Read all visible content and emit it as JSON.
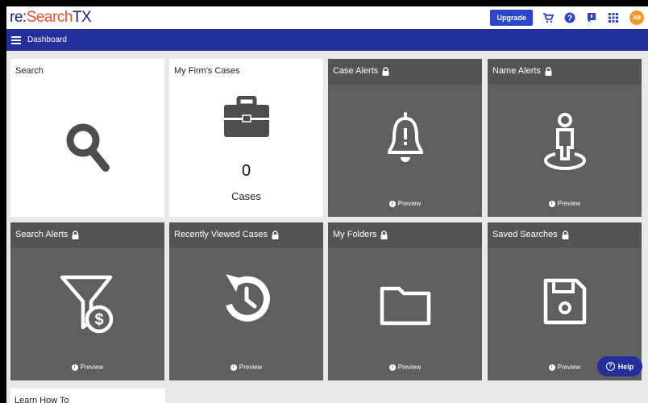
{
  "brand": {
    "part1": "re:",
    "part2": "Search",
    "part3": "TX"
  },
  "header": {
    "upgrade_label": "Upgrade",
    "icons": [
      "cart-icon",
      "help-circle-icon",
      "notification-icon",
      "apps-grid-icon"
    ],
    "avatar_initials": "AB"
  },
  "nav": {
    "title": "Dashboard"
  },
  "tiles": [
    {
      "label": "Search",
      "icon": "search-icon",
      "locked": false
    },
    {
      "label": "My Firm's Cases",
      "icon": "briefcase-icon",
      "locked": false,
      "count": "0",
      "count_label": "Cases"
    },
    {
      "label": "Case Alerts",
      "icon": "bell-alert-icon",
      "locked": true,
      "preview": "Preview"
    },
    {
      "label": "Name Alerts",
      "icon": "person-pin-icon",
      "locked": true,
      "preview": "Preview"
    },
    {
      "label": "Search Alerts",
      "icon": "funnel-dollar-icon",
      "locked": true,
      "preview": "Preview"
    },
    {
      "label": "Recently Viewed Cases",
      "icon": "history-icon",
      "locked": true,
      "preview": "Preview"
    },
    {
      "label": "My Folders",
      "icon": "folder-icon",
      "locked": true,
      "preview": "Preview"
    },
    {
      "label": "Saved Searches",
      "icon": "floppy-disk-icon",
      "locked": true,
      "preview": "Preview"
    }
  ],
  "learn": {
    "label": "Learn How To"
  },
  "help": {
    "label": "Help"
  },
  "colors": {
    "brand_blue": "#232f9c",
    "brand_orange": "#e0532f",
    "upgrade_blue": "#2c46c9",
    "tile_dark": "#5f5f5f",
    "avatar_orange": "#f39a2c"
  }
}
